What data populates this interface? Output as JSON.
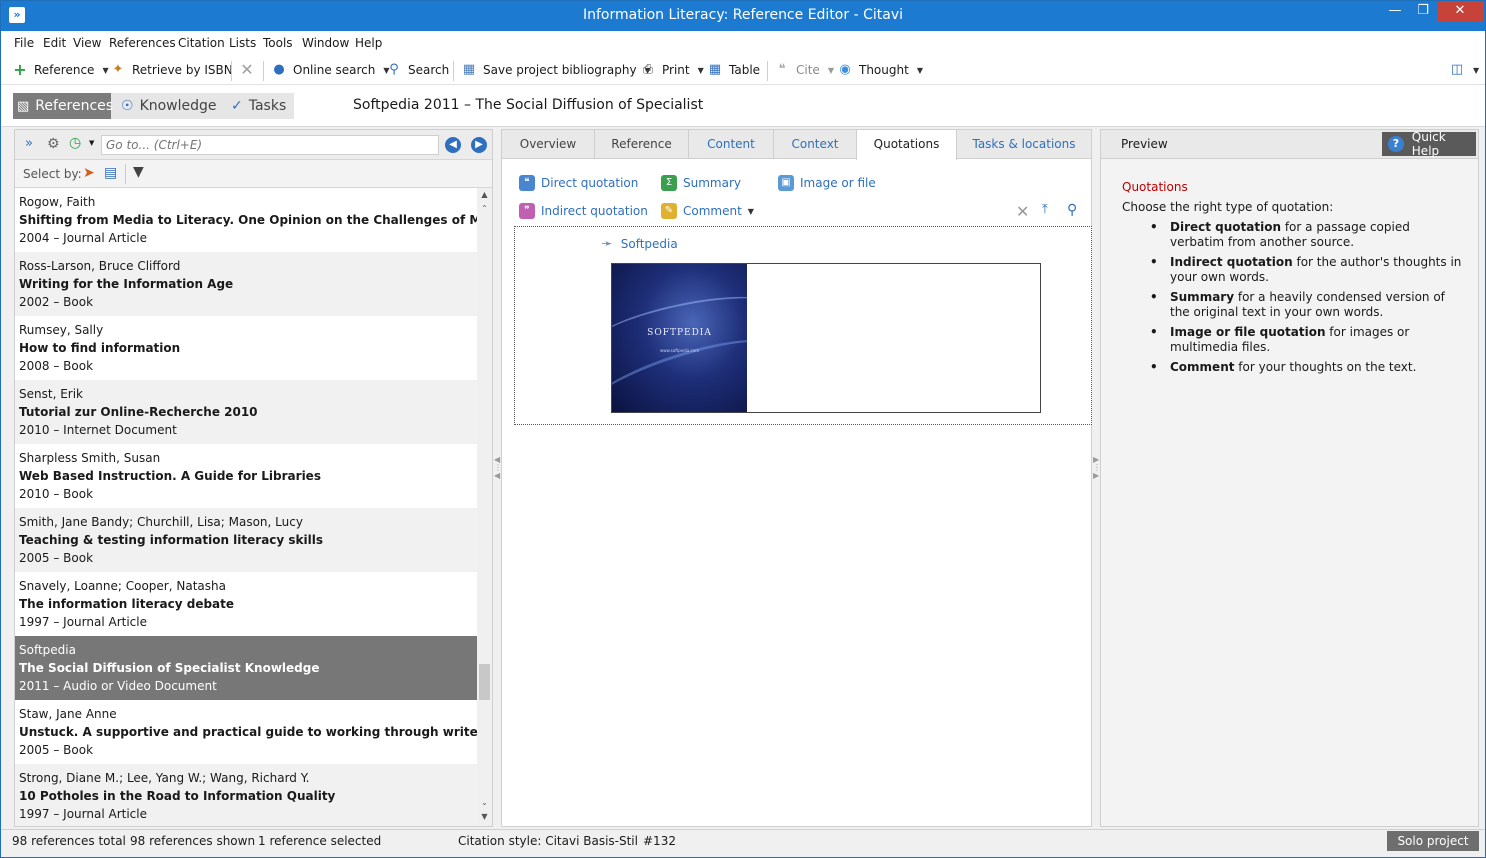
{
  "window": {
    "title": "Information Literacy: Reference Editor - Citavi"
  },
  "menu": [
    "File",
    "Edit",
    "View",
    "References",
    "Citation",
    "Lists",
    "Tools",
    "Window",
    "Help"
  ],
  "toolbar": {
    "reference": "Reference",
    "retrieve_isbn": "Retrieve by ISBN",
    "online_search": "Online search",
    "search": "Search",
    "save_bibliography": "Save project bibliography",
    "print": "Print",
    "table": "Table",
    "cite": "Cite",
    "thought": "Thought"
  },
  "nav": {
    "references": "References",
    "knowledge": "Knowledge",
    "tasks": "Tasks"
  },
  "view_title": "Softpedia 2011 – The Social Diffusion of Specialist",
  "left": {
    "goto_placeholder": "Go to... (Ctrl+E)",
    "select_by": "Select by:",
    "references": [
      {
        "author": "Rogow, Faith",
        "title": "Shifting from Media to Literacy. One Opinion on the Challenges of Media Literacy",
        "year_type": "2004 – Journal Article",
        "selected": false
      },
      {
        "author": "Ross-Larson, Bruce Clifford",
        "title": "Writing for the Information Age",
        "year_type": "2002 – Book",
        "selected": false
      },
      {
        "author": "Rumsey, Sally",
        "title": "How to find information",
        "year_type": "2008 – Book",
        "selected": false
      },
      {
        "author": "Senst, Erik",
        "title": "Tutorial zur Online-Recherche 2010",
        "year_type": "2010 – Internet Document",
        "selected": false
      },
      {
        "author": "Sharpless Smith, Susan",
        "title": "Web Based Instruction. A Guide for Libraries",
        "year_type": "2010 – Book",
        "selected": false
      },
      {
        "author": "Smith, Jane Bandy; Churchill, Lisa; Mason, Lucy",
        "title": "Teaching & testing information literacy skills",
        "year_type": "2005 – Book",
        "selected": false
      },
      {
        "author": "Snavely, Loanne; Cooper, Natasha",
        "title": "The information literacy debate",
        "year_type": "1997 – Journal Article",
        "selected": false
      },
      {
        "author": "Softpedia",
        "title": "The Social Diffusion of Specialist Knowledge",
        "year_type": "2011 – Audio or Video Document",
        "selected": true
      },
      {
        "author": "Staw, Jane Anne",
        "title": "Unstuck. A supportive and practical guide to working through writer's block",
        "year_type": "2005 – Book",
        "selected": false
      },
      {
        "author": "Strong, Diane M.; Lee, Yang W.; Wang, Richard Y.",
        "title": "10 Potholes in the Road to Information Quality",
        "year_type": "1997 – Journal Article",
        "selected": false
      }
    ]
  },
  "tabs": [
    "Overview",
    "Reference",
    "Content",
    "Context",
    "Quotations",
    "Tasks & locations"
  ],
  "active_tab": "Quotations",
  "quotations": {
    "direct": "Direct quotation",
    "summary": "Summary",
    "image_or_file": "Image or file",
    "indirect": "Indirect quotation",
    "comment": "Comment",
    "source": "Softpedia",
    "thumb_brand": "SOFTPEDIA",
    "thumb_url": "www.softpedia.com"
  },
  "preview": {
    "header": "Preview",
    "quick_help": "Quick Help",
    "heading": "Quotations",
    "intro": "Choose the right type of quotation:",
    "items": [
      {
        "term": "Direct quotation",
        "desc": " for a passage copied verbatim from another source."
      },
      {
        "term": "Indirect quotation",
        "desc": " for the author's thoughts in your own words."
      },
      {
        "term": "Summary",
        "desc": " for a heavily condensed version of the original text in your own words."
      },
      {
        "term": "Image or file quotation",
        "desc": " for images or multimedia files."
      },
      {
        "term": "Comment",
        "desc": " for your thoughts on the text."
      }
    ]
  },
  "status": {
    "total": "98 references total",
    "shown": "98 references shown",
    "selected": "1 reference selected",
    "citation_style": "Citation style: Citavi Basis-Stil",
    "id": "#132",
    "project": "Solo project"
  },
  "colors": {
    "titlebar": "#1c7ad0",
    "link": "#2f6fbf",
    "selected_row": "#777777",
    "help_heading": "#c00000"
  }
}
